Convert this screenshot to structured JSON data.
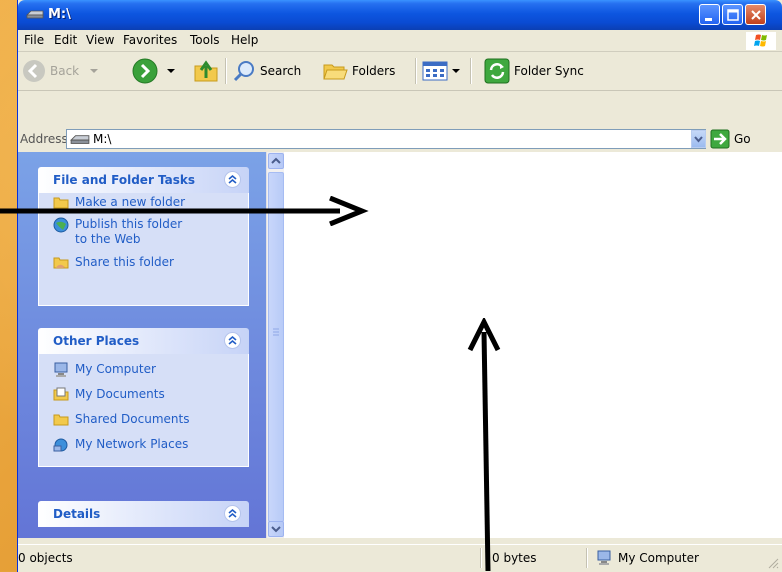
{
  "window": {
    "title": "M:\\"
  },
  "menu": [
    "File",
    "Edit",
    "View",
    "Favorites",
    "Tools",
    "Help"
  ],
  "toolbar": {
    "back": "Back",
    "search": "Search",
    "folders": "Folders",
    "folder_sync": "Folder Sync"
  },
  "address": {
    "label": "Address",
    "value": "M:\\",
    "go": "Go"
  },
  "sidebar": {
    "file_tasks": {
      "title": "File and Folder Tasks",
      "items": [
        "Make a new folder",
        "Publish this folder to the Web",
        "Share this folder"
      ]
    },
    "other_places": {
      "title": "Other Places",
      "items": [
        "My Computer",
        "My Documents",
        "Shared Documents",
        "My Network Places"
      ]
    },
    "details": {
      "title": "Details"
    }
  },
  "status": {
    "objects": "0 objects",
    "size": "0 bytes",
    "zone": "My Computer"
  },
  "colors": {
    "accent": "#0A4BD3",
    "link": "#215DC6",
    "desktop": "#E6A33A"
  }
}
